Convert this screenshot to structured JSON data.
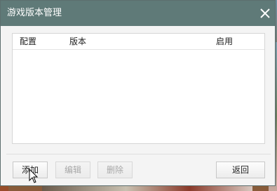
{
  "window": {
    "title": "游戏版本管理",
    "close_icon": "close-icon"
  },
  "list": {
    "columns": [
      "配置",
      "版本",
      "启用"
    ],
    "rows": []
  },
  "buttons": {
    "add": "添加",
    "edit": "编辑",
    "delete": "删除",
    "back": "返回"
  },
  "colors": {
    "titlebar": "#5f7a78",
    "disabled_text": "#a8a8a8"
  }
}
